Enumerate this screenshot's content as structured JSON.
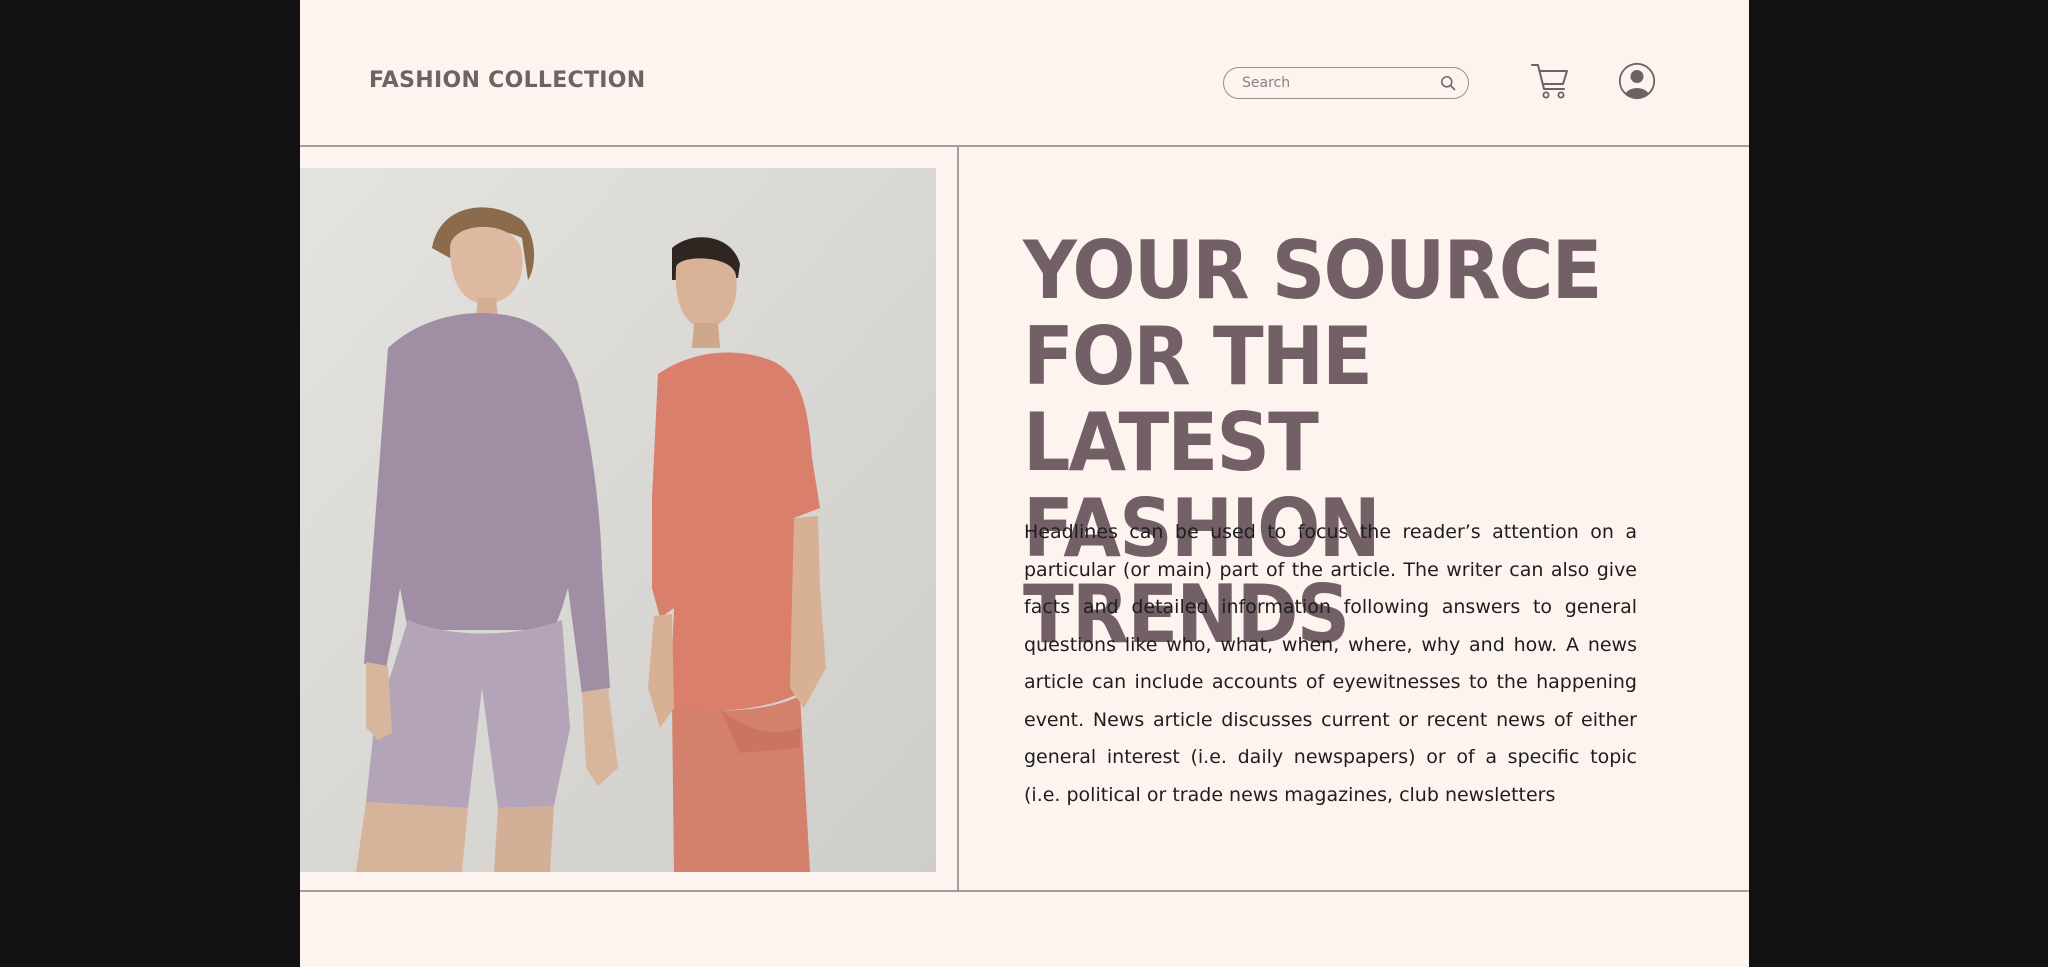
{
  "header": {
    "brand": "FASHION COLLECTION",
    "search_placeholder": "Search",
    "icons": {
      "search": "search-icon",
      "cart": "cart-icon",
      "account": "user-icon"
    }
  },
  "hero": {
    "image_alt": "Two models wearing lavender and coral loungewear sets",
    "headline": "YOUR SOURCE FOR THE LATEST FASHION TRENDS",
    "body": "Headlines can be used to focus the reader’s attention on a particular (or main) part of the article. The writer can also give facts and detailed information following answers to general questions like who, what, when, where, why and how. A news article can include accounts of eyewitnesses to the happening event.  News article discusses current or recent news of either general interest (i.e. daily newspapers) or of a specific topic (i.e. political or trade news magazines, club newsletters"
  },
  "colors": {
    "background": "#fdf3ef",
    "frame": "#111111",
    "headline": "#735f66",
    "brand_text": "#6f6264",
    "divider": "#a79c9d"
  }
}
